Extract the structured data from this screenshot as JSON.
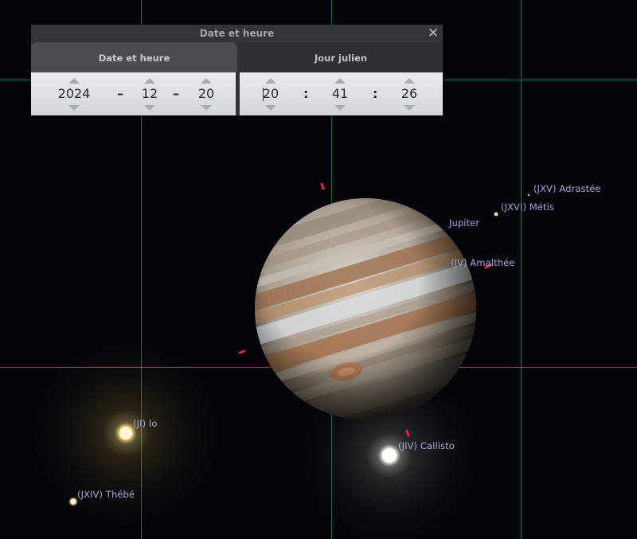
{
  "dialog": {
    "title": "Date et heure",
    "close_icon": "close-icon",
    "tabs": [
      {
        "label": "Date et heure",
        "active": true
      },
      {
        "label": "Jour julien",
        "active": false
      }
    ],
    "date": {
      "year": "2024",
      "sep1": "–",
      "month": "12",
      "sep2": "–",
      "day": "20"
    },
    "time": {
      "hour": "20",
      "sep1": ":",
      "minute": "41",
      "sep2": ":",
      "second": "26"
    }
  },
  "sky": {
    "objects": [
      {
        "label": "(JXV) Adrastée"
      },
      {
        "label": "(JXVI) Métis"
      },
      {
        "label": "Jupiter"
      },
      {
        "label": "(JV) Amalthée"
      },
      {
        "label": "(JI) Io"
      },
      {
        "label": "(JIV) Callisto"
      },
      {
        "label": "(JXIV) Thébé"
      }
    ],
    "grid_color": "#1c6a5e",
    "label_color": "#a9a6d6",
    "marker_color": "#e0293a"
  }
}
